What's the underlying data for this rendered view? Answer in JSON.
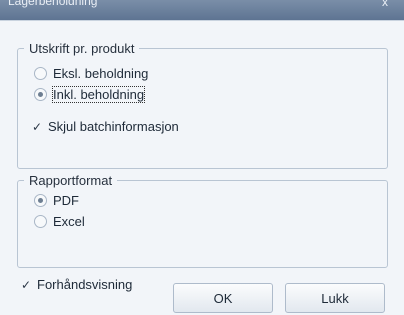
{
  "window": {
    "title": "Lagerbeholdning",
    "close_glyph": "x"
  },
  "group_product": {
    "legend": "Utskrift pr. produkt",
    "options": [
      {
        "label": "Eksl. beholdning",
        "selected": false
      },
      {
        "label": "Inkl. beholdning",
        "selected": true
      }
    ],
    "hide_batch": {
      "label": "Skjul batchinformasjon",
      "checked": true
    }
  },
  "group_format": {
    "legend": "Rapportformat",
    "options": [
      {
        "label": "PDF",
        "selected": true
      },
      {
        "label": "Excel",
        "selected": false
      }
    ]
  },
  "footer": {
    "preview": {
      "label": "Forhåndsvisning",
      "checked": true
    },
    "ok_label": "OK",
    "close_label": "Lukk"
  },
  "glyphs": {
    "check": "✓"
  }
}
